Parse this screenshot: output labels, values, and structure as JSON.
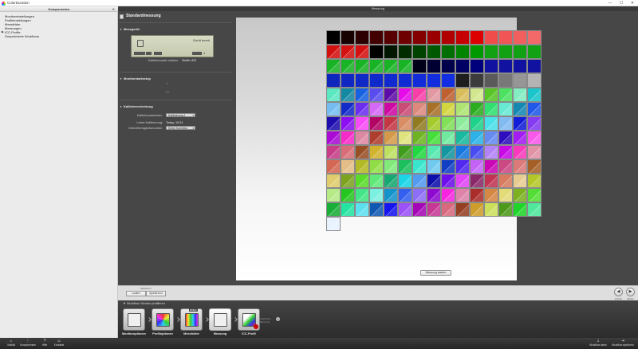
{
  "window": {
    "title": "ColorDuration",
    "controls": [
      "—",
      "☐",
      "✕"
    ]
  },
  "left_panel": {
    "header": "Komponenten",
    "close": "✕",
    "items": [
      {
        "label": "Monitoreinstellungen",
        "arrow": ""
      },
      {
        "label": "Profileinstellungen",
        "arrow": ""
      },
      {
        "label": "Messfelder",
        "arrow": ""
      },
      {
        "label": "Messungen",
        "arrow": ""
      },
      {
        "label": "ICC-Profile",
        "arrow": "▶"
      },
      {
        "label": "Gespeicherte Workflows",
        "arrow": ""
      }
    ]
  },
  "main": {
    "bar_title": "Messung",
    "panel_title": "Standardmessung",
    "sections": {
      "messgeraet": "Messgerät",
      "monitorsetup": "Monitorstartsetup",
      "kalibrierung": "Kalibrierverichtung"
    },
    "device": {
      "name": "Gerät bereit",
      "calib_label": "Kalibriermatrix wählen:",
      "calib_value": "Steffe LED",
      "pill1": "",
      "pill2": "",
      "pill3": "",
      "count": "4"
    },
    "kalibrierung": {
      "param_label": "Kalibrierparameter:",
      "param_value": "Kalibrierung 1",
      "last_label": "Letzte Kalibrierung:",
      "last_value": "Today, 10:21",
      "temp_label": "Gleichförmigkeitsmonitor:",
      "temp_value": "Keine Korrektur"
    },
    "start_button": "Messung starten"
  },
  "toolbar2": {
    "group_label": "Speichern",
    "load": "Laden",
    "save": "Speichern",
    "back_label": "Zurück",
    "next_label": "Weiter",
    "back": "◀",
    "next": "▶"
  },
  "workflow": {
    "title": "Workflow: Monitor profilieren",
    "items": [
      "Monitoroptionen",
      "Profiloptionen",
      "Messfelder",
      "Messung",
      "ICC-Profil"
    ],
    "badge": "EMEA",
    "extra": "Zusätzliche Messung"
  },
  "statusbar": {
    "left": [
      {
        "icon": "⌂",
        "label": "Vollbild"
      },
      {
        "icon": "⋮",
        "label": "Komponenten"
      },
      {
        "icon": "?",
        "label": "Hilfe"
      },
      {
        "icon": "☺",
        "label": "Kontakte"
      }
    ],
    "right": [
      {
        "icon": "⇣",
        "label": "Workflow laden"
      },
      {
        "icon": "⇥",
        "label": "Workflow speichern"
      }
    ]
  },
  "colors": {
    "accent": "#474747",
    "panel": "#ebebeb"
  }
}
